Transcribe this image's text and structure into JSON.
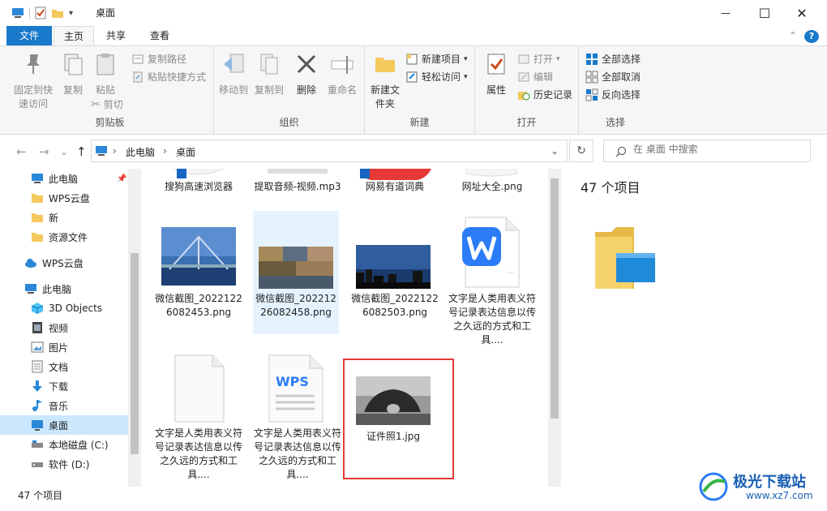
{
  "window": {
    "title": "桌面",
    "minimize": "—",
    "maximize": "☐",
    "close": "✕"
  },
  "tabs": {
    "file": "文件",
    "home": "主页",
    "share": "共享",
    "view": "查看",
    "collapse": "⌃",
    "help": "?"
  },
  "ribbon": {
    "clipboard": {
      "label": "剪贴板",
      "pin": "固定到快速访问",
      "copy": "复制",
      "paste": "粘贴",
      "copy_path": "复制路径",
      "paste_shortcut": "粘贴快捷方式",
      "cut": "剪切"
    },
    "organize": {
      "label": "组织",
      "move_to": "移动到",
      "copy_to": "复制到",
      "delete": "删除",
      "rename": "重命名"
    },
    "new": {
      "label": "新建",
      "new_folder": "新建文件夹",
      "new_item": "新建项目",
      "easy_access": "轻松访问"
    },
    "open": {
      "label": "打开",
      "properties": "属性",
      "open": "打开",
      "edit": "编辑",
      "history": "历史记录"
    },
    "select": {
      "label": "选择",
      "select_all": "全部选择",
      "select_none": "全部取消",
      "invert": "反向选择"
    }
  },
  "address": {
    "back": "←",
    "forward": "→",
    "recent": "⌄",
    "up": "↑",
    "crumb_pc": "此电脑",
    "crumb_desktop": "桌面",
    "dropdown": "⌄",
    "refresh": "↻",
    "search_placeholder": "在 桌面 中搜索"
  },
  "nav": {
    "items": [
      {
        "label": "此电脑",
        "icon": "pc-icon"
      },
      {
        "label": "WPS云盘",
        "icon": "folder-icon"
      },
      {
        "label": "新",
        "icon": "folder-icon"
      },
      {
        "label": "资源文件",
        "icon": "folder-icon"
      },
      {
        "label": "WPS云盘",
        "icon": "cloud-icon"
      },
      {
        "label": "此电脑",
        "icon": "pc-icon"
      },
      {
        "label": "3D Objects",
        "icon": "cube-icon"
      },
      {
        "label": "视频",
        "icon": "video-icon"
      },
      {
        "label": "图片",
        "icon": "picture-icon"
      },
      {
        "label": "文档",
        "icon": "document-icon"
      },
      {
        "label": "下载",
        "icon": "download-icon"
      },
      {
        "label": "音乐",
        "icon": "music-icon"
      },
      {
        "label": "桌面",
        "icon": "desktop-icon"
      },
      {
        "label": "本地磁盘 (C:)",
        "icon": "disk-icon"
      },
      {
        "label": "软件 (D:)",
        "icon": "disk-icon"
      }
    ]
  },
  "files": [
    {
      "label": "搜狗高速浏览器"
    },
    {
      "label": "提取音频-视频.mp3"
    },
    {
      "label": "网易有道词典"
    },
    {
      "label": "网址大全.png"
    },
    {
      "label": "微信截图_20221226082453.png"
    },
    {
      "label": "微信截图_20221226082458.png"
    },
    {
      "label": "微信截图_20221226082503.png"
    },
    {
      "label": "文字是人类用表义符号记录表达信息以传之久远的方式和工具...."
    },
    {
      "label": "文字是人类用表义符号记录表达信息以传之久远的方式和工具...."
    },
    {
      "label": "文字是人类用表义符号记录表达信息以传之久远的方式和工具...."
    },
    {
      "label": "证件照1.jpg"
    }
  ],
  "preview": {
    "count": "47 个项目"
  },
  "status": {
    "count": "47 个项目"
  },
  "watermark": {
    "text": "极光下载站",
    "url": "www.xz7.com"
  },
  "colors": {
    "accent": "#1979ca",
    "selection": "#cce8ff",
    "highlight_box": "#e53935"
  }
}
